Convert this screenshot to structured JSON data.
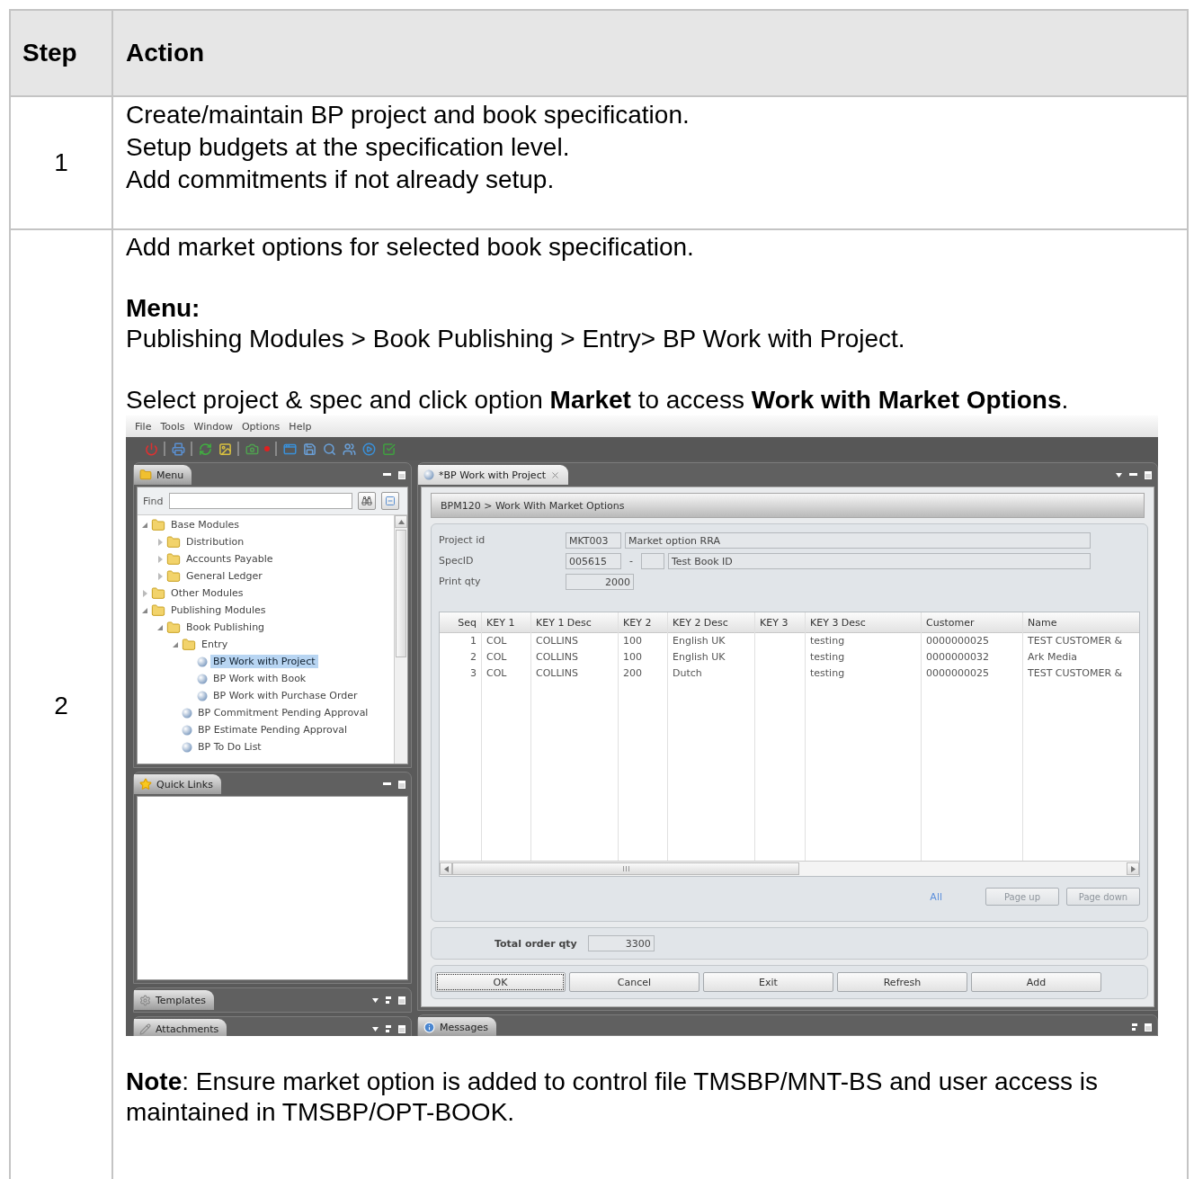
{
  "table": {
    "columns": [
      {
        "label": "Step"
      },
      {
        "label": "Action"
      }
    ],
    "rows": [
      {
        "step": "1",
        "paragraphs": [
          [
            {
              "kind": "text",
              "text": "Create/maintain BP project and book specification."
            },
            {
              "kind": "text",
              "text": "Setup budgets at the specification level."
            },
            {
              "kind": "text",
              "text": "Add commitments if not already setup."
            }
          ]
        ]
      },
      {
        "step": "2",
        "paragraphs": [
          [
            {
              "kind": "text",
              "text": "Add market options for selected book specification."
            }
          ],
          [
            {
              "kind": "heading",
              "text": "Menu:"
            },
            {
              "kind": "text",
              "text": "Publishing Modules > Book Publishing > Entry> BP Work with Project."
            }
          ],
          [
            {
              "kind": "text",
              "text": "Select project & spec and click option **Market** to access **Work with Market Options**."
            },
            {
              "kind": "screenshot",
              "app": {
                "menubar": [
                  "File",
                  "Tools",
                  "Window",
                  "Options",
                  "Help"
                ],
                "menu_panel": {
                  "tab": "Menu",
                  "find_label": "Find",
                  "tree": [
                    {
                      "label": "Base Modules",
                      "kind": "folder",
                      "expanded": true,
                      "selected": false,
                      "children": [
                        {
                          "label": "Distribution",
                          "kind": "folder",
                          "expanded": false,
                          "selected": false
                        },
                        {
                          "label": "Accounts Payable",
                          "kind": "folder",
                          "expanded": false,
                          "selected": false
                        },
                        {
                          "label": "General Ledger",
                          "kind": "folder",
                          "expanded": false,
                          "selected": false
                        }
                      ]
                    },
                    {
                      "label": "Other Modules",
                      "kind": "folder",
                      "expanded": false,
                      "selected": false
                    },
                    {
                      "label": "Publishing Modules",
                      "kind": "folder",
                      "expanded": true,
                      "selected": false,
                      "children": [
                        {
                          "label": "Book Publishing",
                          "kind": "folder",
                          "expanded": true,
                          "selected": false,
                          "children": [
                            {
                              "label": "Entry",
                              "kind": "folder",
                              "expanded": true,
                              "selected": false,
                              "children": [
                                {
                                  "label": "BP Work with Project",
                                  "kind": "leaf",
                                  "selected": true
                                },
                                {
                                  "label": "BP Work with Book",
                                  "kind": "leaf",
                                  "selected": false
                                },
                                {
                                  "label": "BP Work with Purchase Order",
                                  "kind": "leaf",
                                  "selected": false
                                }
                              ]
                            },
                            {
                              "label": "BP Commitment Pending Approval",
                              "kind": "leaf",
                              "selected": false
                            },
                            {
                              "label": "BP Estimate Pending Approval",
                              "kind": "leaf",
                              "selected": false
                            },
                            {
                              "label": "BP To Do List",
                              "kind": "leaf",
                              "selected": false
                            }
                          ]
                        }
                      ]
                    }
                  ]
                },
                "quick_links_panel": {
                  "tab": "Quick Links"
                },
                "collapsed_panels": [
                  {
                    "tab": "Templates",
                    "kind": "templates"
                  },
                  {
                    "tab": "Attachments",
                    "kind": "attachments"
                  }
                ],
                "editor": {
                  "tab": "*BP Work with Project",
                  "breadcrumb": "BPM120 > Work With Market Options",
                  "fields": [
                    {
                      "kind": "code",
                      "label": "Project id",
                      "code": "MKT003",
                      "description": "Market option RRA"
                    },
                    {
                      "kind": "spec",
                      "label": "SpecID",
                      "code": "005615",
                      "separator": "-",
                      "description": "Test Book ID"
                    },
                    {
                      "kind": "number",
                      "label": "Print qty",
                      "value": "2000"
                    }
                  ],
                  "grid": {
                    "columns": [
                      "Seq",
                      "KEY 1",
                      "KEY 1 Desc",
                      "KEY 2",
                      "KEY 2 Desc",
                      "KEY 3",
                      "KEY 3 Desc",
                      "Customer",
                      "Name"
                    ],
                    "rows": [
                      [
                        "1",
                        "COL",
                        "COLLINS",
                        "100",
                        "English UK",
                        null,
                        "testing",
                        "0000000025",
                        "TEST CUSTOMER &"
                      ],
                      [
                        "2",
                        "COL",
                        "COLLINS",
                        "100",
                        "English UK",
                        null,
                        "testing",
                        "0000000032",
                        "Ark Media"
                      ],
                      [
                        "3",
                        "COL",
                        "COLLINS",
                        "200",
                        "Dutch",
                        null,
                        "testing",
                        "0000000025",
                        "TEST CUSTOMER &"
                      ]
                    ]
                  },
                  "link": "All",
                  "pager": [
                    {
                      "label": "Page up",
                      "disabled": true
                    },
                    {
                      "label": "Page down",
                      "disabled": true
                    }
                  ],
                  "total": {
                    "label": "Total order qty",
                    "value": "3300"
                  },
                  "buttons": [
                    {
                      "label": "OK",
                      "focused": true
                    },
                    {
                      "label": "Cancel",
                      "focused": false
                    },
                    {
                      "label": "Exit",
                      "focused": false
                    },
                    {
                      "label": "Refresh",
                      "focused": false
                    },
                    {
                      "label": "Add",
                      "focused": false
                    }
                  ]
                },
                "bottom_tab": "Messages"
              }
            }
          ],
          [
            {
              "kind": "note",
              "text": "**Note**: Ensure market option is added to control file TMSBP/MNT-BS and user access is maintained in TMSBP/OPT-BOOK."
            }
          ]
        ]
      }
    ]
  }
}
